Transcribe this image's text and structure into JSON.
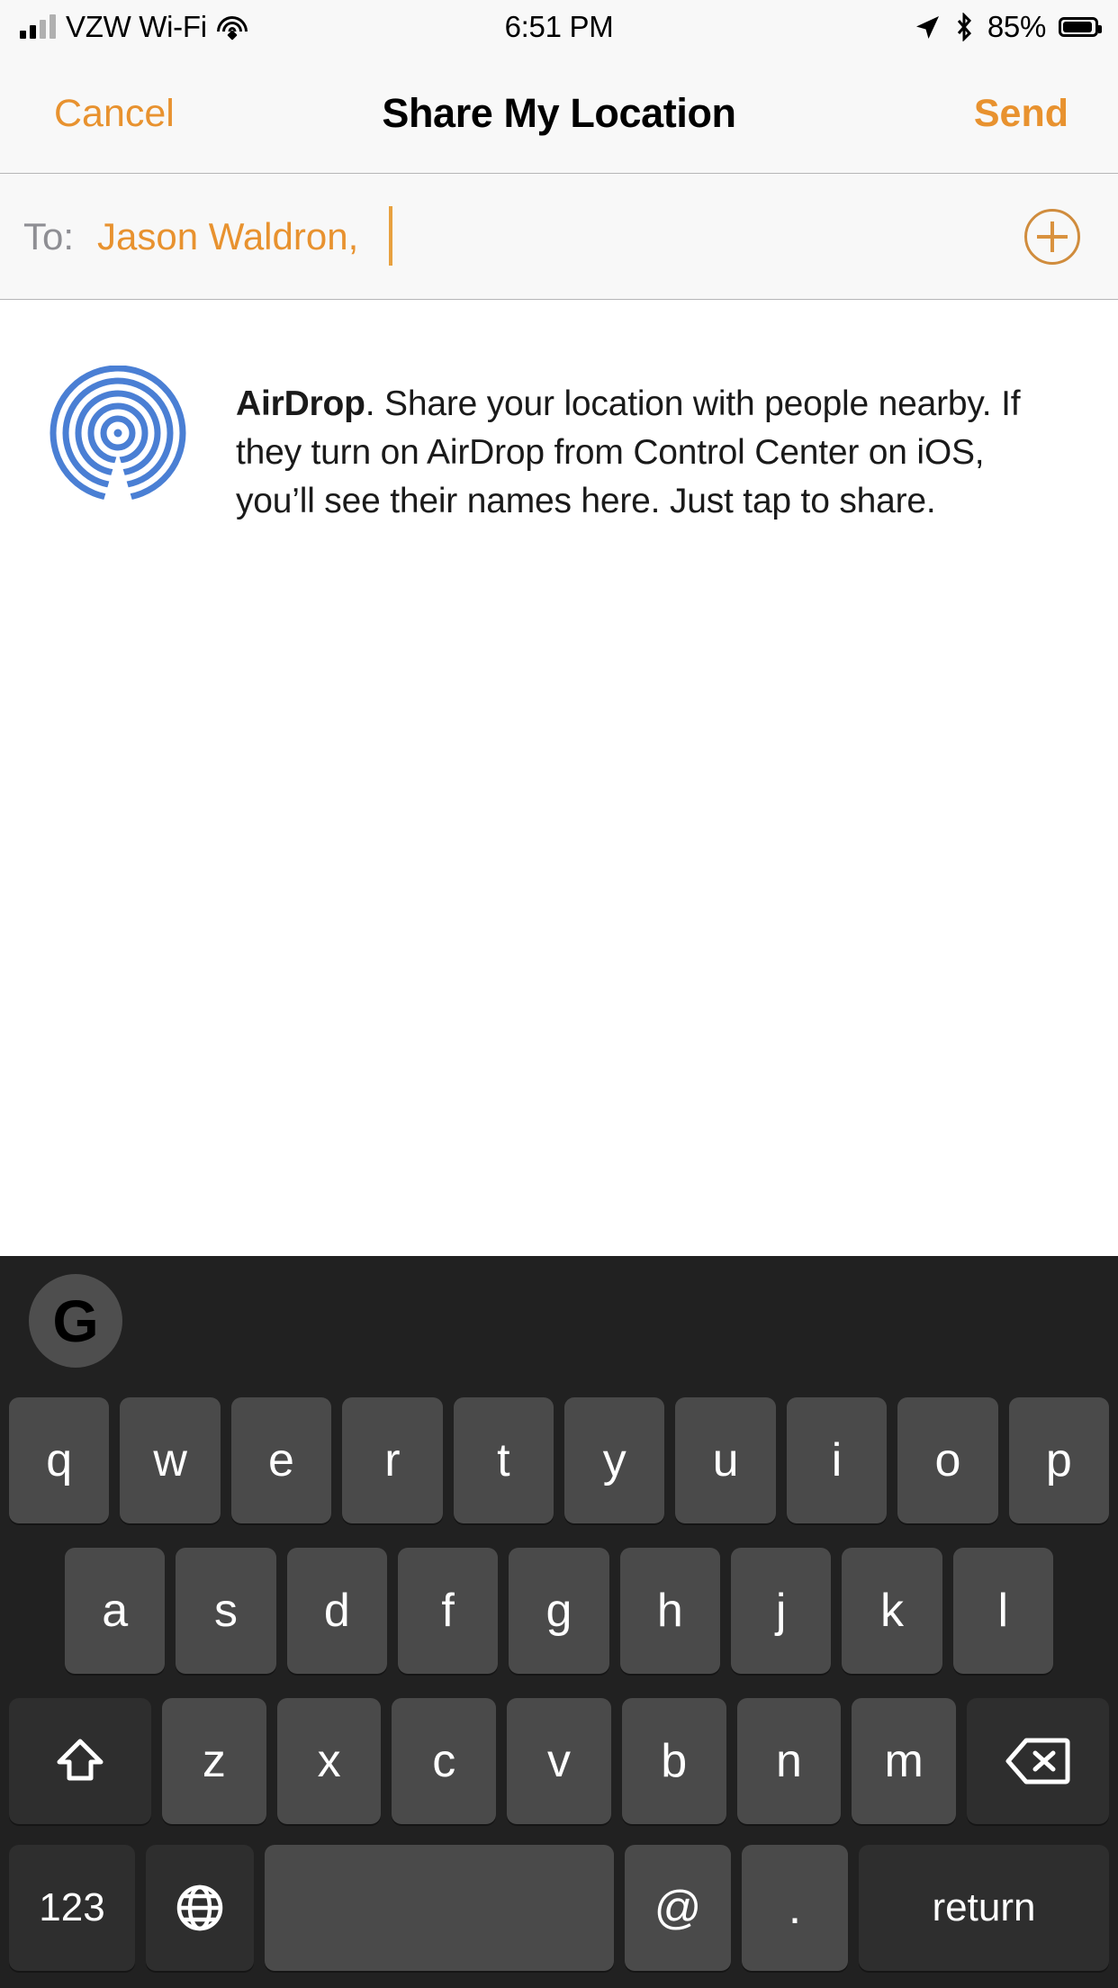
{
  "status_bar": {
    "carrier": "VZW Wi-Fi",
    "time": "6:51 PM",
    "battery_percent": "85%",
    "icons": [
      "signal-bars-icon",
      "wifi-icon",
      "location-arrow-icon",
      "bluetooth-icon",
      "battery-icon"
    ]
  },
  "nav_bar": {
    "cancel_label": "Cancel",
    "title": "Share My Location",
    "send_label": "Send",
    "accent_color": "#e8922f"
  },
  "to_field": {
    "label": "To:",
    "recipients": "Jason Waldron,",
    "placeholder": "",
    "add_contact_icon": "plus-circle-icon"
  },
  "airdrop": {
    "icon": "airdrop-icon",
    "icon_color": "#4a7fd4",
    "title": "AirDrop",
    "body": ". Share your location with people nearby. If they turn on AirDrop from Control Center on iOS, you’ll see their names here. Just tap to share."
  },
  "keyboard": {
    "theme": "dark",
    "background": "#212121",
    "key_color": "#4a4a4a",
    "fn_key_color": "#2e2e2e",
    "toolbar_logo": "G",
    "toolbar_logo_name": "gboard-logo-icon",
    "row1": [
      "q",
      "w",
      "e",
      "r",
      "t",
      "y",
      "u",
      "i",
      "o",
      "p"
    ],
    "row2": [
      "a",
      "s",
      "d",
      "f",
      "g",
      "h",
      "j",
      "k",
      "l"
    ],
    "row3_letters": [
      "z",
      "x",
      "c",
      "v",
      "b",
      "n",
      "m"
    ],
    "shift_icon": "shift-arrow-icon",
    "backspace_icon": "backspace-icon",
    "row4": {
      "numbers_label": "123",
      "globe_icon": "globe-icon",
      "space_label": "",
      "at_label": "@",
      "period_label": ".",
      "return_label": "return"
    }
  }
}
